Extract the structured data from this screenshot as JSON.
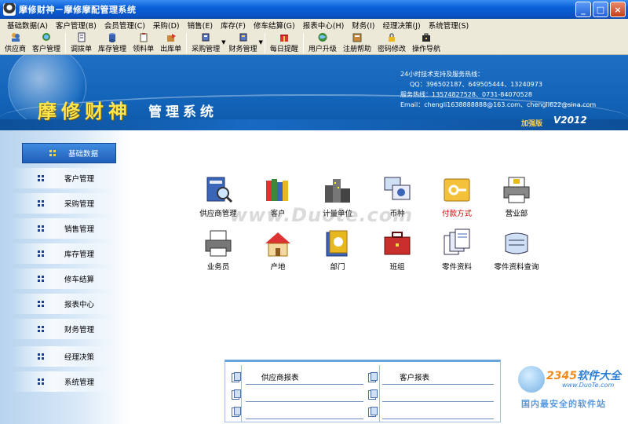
{
  "window": {
    "title": "摩修财神－摩修摩配管理系统",
    "minimize": "_",
    "maximize": "□",
    "close": "×"
  },
  "menu": [
    "基础数据(A)",
    "客户管理(B)",
    "会员管理(C)",
    "采购(D)",
    "销售(E)",
    "库存(F)",
    "修车结算(G)",
    "报表中心(H)",
    "财务(I)",
    "经理决策(J)",
    "系统管理(S)"
  ],
  "toolbar": {
    "supplier": "供应商",
    "customer_mgmt": "客户管理",
    "transfer": "调拨单",
    "stock_mgmt": "库存管理",
    "requisition": "领料单",
    "outbound": "出库单",
    "purchase_mgmt": "采购管理",
    "finance_mgmt": "财务管理",
    "daily_reminder": "每日提醒",
    "user_upgrade": "用户升级",
    "register_help": "注册帮助",
    "password_change": "密码修改",
    "guide": "操作导航"
  },
  "banner": {
    "brand_big": "摩修财神",
    "brand_small": "管理系统",
    "hotline_title": "24小时技术支持及服务热线：",
    "qq": "QQ：396502187、649505444、13240973",
    "phone": "服务热线：13574827528、0731-84070528",
    "email": "Email：chengli1638888888@163.com、chengli622@sina.com",
    "edition": "加强版",
    "version": "V2012"
  },
  "sidebar": [
    {
      "label": "基础数据",
      "active": true
    },
    {
      "label": "客户管理",
      "active": false
    },
    {
      "label": "采购管理",
      "active": false
    },
    {
      "label": "销售管理",
      "active": false
    },
    {
      "label": "库存管理",
      "active": false
    },
    {
      "label": "修车结算",
      "active": false
    },
    {
      "label": "报表中心",
      "active": false
    },
    {
      "label": "财务管理",
      "active": false
    },
    {
      "label": "经理决策",
      "active": false
    },
    {
      "label": "系统管理",
      "active": false
    }
  ],
  "icons": {
    "row1": [
      "供应商管理",
      "客户",
      "计量单位",
      "币种",
      "付款方式",
      "营业部"
    ],
    "row2": [
      "业务员",
      "产地",
      "部门",
      "班组",
      "零件资料",
      "零件资料查询"
    ]
  },
  "watermark": "www.Duote.com",
  "reports": {
    "supplier_report": "供应商报表",
    "customer_report": "客户报表"
  },
  "logo": {
    "name_prefix": "2345",
    "name_suffix": "软件大全",
    "url": "www.DuoTe.com",
    "slogan": "国内最安全的软件站"
  },
  "colors": {
    "titlebar": "#0a5fd8",
    "banner": "#1264b9",
    "brand_yellow": "#ffe64d",
    "highlight_red": "#d40000"
  }
}
